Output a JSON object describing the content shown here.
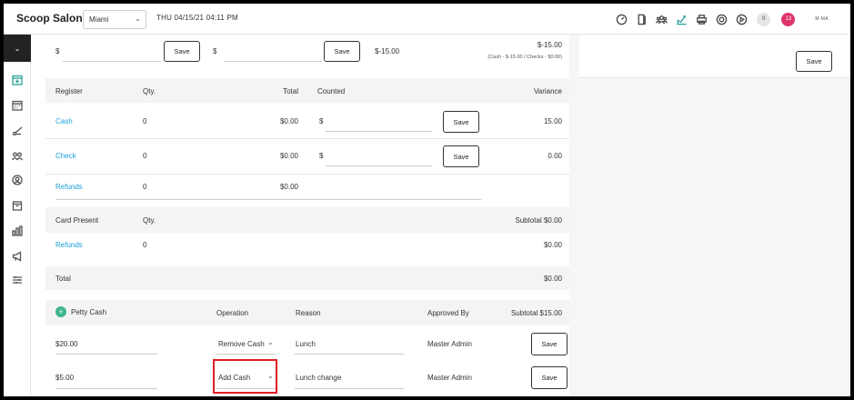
{
  "header": {
    "brand": "Scoop Salon",
    "location": "Miami",
    "datetime": "THU 04/15/21  04:11 PM",
    "icons": [
      "gauge-icon",
      "door-icon",
      "users-group-icon",
      "chart-upload-icon",
      "printer-icon",
      "lifebuoy-icon",
      "play-circle-icon"
    ],
    "badge_count": "0",
    "notification_count": "13",
    "user": "M MA"
  },
  "sidebar": {
    "toggle": "⌄",
    "items": [
      "add-appointment-icon",
      "calendar-icon",
      "scissors-icon",
      "clients-icon",
      "staff-icon",
      "products-icon",
      "reports-icon",
      "marketing-icon",
      "settings-sliders-icon"
    ]
  },
  "top_row": {
    "currency1": "$",
    "save1": "Save",
    "currency2": "$",
    "save2": "Save",
    "value": "$-15.00",
    "summary_value": "$-15.00",
    "summary_detail": "(Cash - $-15.00 / Checks - $0.00)",
    "panel_save": "Save"
  },
  "register": {
    "headers": {
      "register": "Register",
      "qty": "Qty.",
      "total": "Total",
      "counted": "Counted",
      "variance": "Variance"
    },
    "rows": [
      {
        "name": "Cash",
        "qty": "0",
        "total": "$0.00",
        "currency": "$",
        "save": "Save",
        "variance": "15.00"
      },
      {
        "name": "Check",
        "qty": "0",
        "total": "$0.00",
        "currency": "$",
        "save": "Save",
        "variance": "0.00"
      },
      {
        "name": "Refunds",
        "qty": "0",
        "total": "$0.00"
      }
    ]
  },
  "card_present": {
    "headers": {
      "label": "Card Present",
      "qty": "Qty.",
      "subtotal": "Subtotal $0.00"
    },
    "rows": [
      {
        "name": "Refunds",
        "qty": "0",
        "amount": "$0.00"
      }
    ]
  },
  "total": {
    "label": "Total",
    "amount": "$0.00"
  },
  "petty_cash": {
    "headers": {
      "label": "Petty Cash",
      "operation": "Operation",
      "reason": "Reason",
      "approved_by": "Approved By",
      "subtotal": "Subtotal $15.00"
    },
    "rows": [
      {
        "amount": "$20.00",
        "operation": "Remove Cash",
        "reason": "Lunch",
        "approved_by": "Master Admin",
        "save": "Save"
      },
      {
        "amount": "$5.00",
        "operation": "Add Cash",
        "reason": "Lunch change",
        "approved_by": "Master Admin",
        "save": "Save"
      }
    ]
  },
  "colors": {
    "link": "#1ba1d8",
    "accent": "#2aa198",
    "highlight": "#e01c24",
    "notification": "#e0356a"
  }
}
